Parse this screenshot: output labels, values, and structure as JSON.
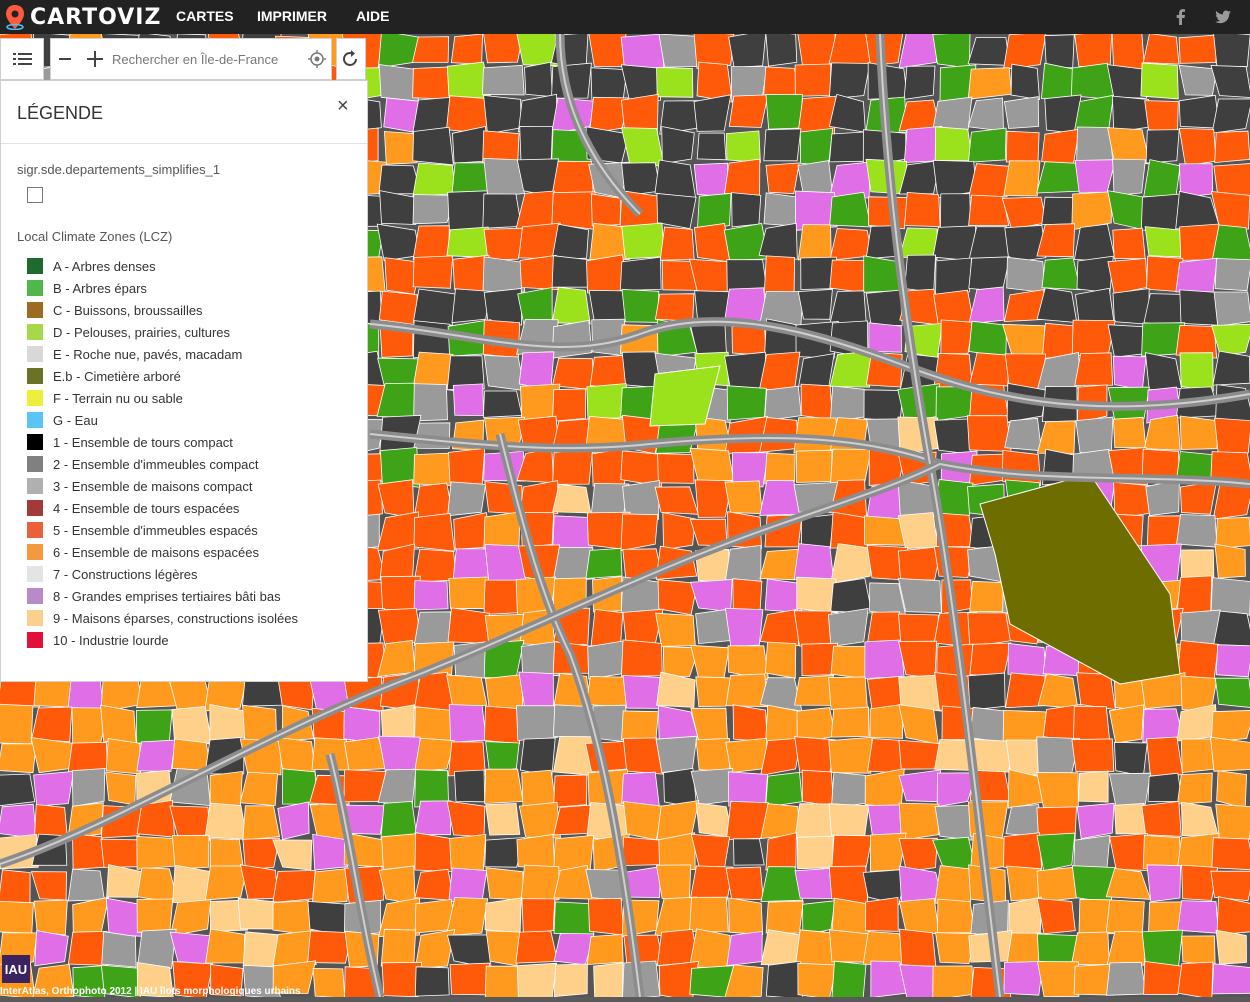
{
  "app": {
    "name": "CARTOVIZ",
    "nav": [
      "CARTES",
      "IMPRIMER",
      "AIDE"
    ],
    "social": [
      {
        "icon": "facebook-icon"
      },
      {
        "icon": "twitter-icon"
      }
    ]
  },
  "toolbar": {
    "search_placeholder": "Rechercher en Île-de-France",
    "buttons": [
      "legend-toggle-icon",
      "zoom-out-icon",
      "zoom-in-icon",
      "geolocate-icon",
      "reset-icon"
    ]
  },
  "legend": {
    "title": "LÉGENDE",
    "close_label": "×",
    "layer_name": "sigr.sde.departements_simplifies_1",
    "lcz_title": "Local Climate Zones (LCZ)",
    "items": [
      {
        "label": "A - Arbres denses",
        "color": "#1f6b2f"
      },
      {
        "label": "B - Arbres épars",
        "color": "#4fb84a"
      },
      {
        "label": "C - Buissons, broussailles",
        "color": "#9c6b21"
      },
      {
        "label": "D - Pelouses, prairies, cultures",
        "color": "#a6d84a"
      },
      {
        "label": "E - Roche nue, pavés, macadam",
        "color": "#d8d8d8"
      },
      {
        "label": "E.b - Cimetière arboré",
        "color": "#6b7226"
      },
      {
        "label": "F - Terrain nu ou sable",
        "color": "#ecf03a"
      },
      {
        "label": "G - Eau",
        "color": "#5bc4f4"
      },
      {
        "label": "1 - Ensemble de tours compact",
        "color": "#000000"
      },
      {
        "label": "2 - Ensemble d'immeubles compact",
        "color": "#808080"
      },
      {
        "label": "3 - Ensemble de maisons compact",
        "color": "#b0b0b0"
      },
      {
        "label": "4 - Ensemble de tours espacées",
        "color": "#a3393b"
      },
      {
        "label": "5 - Ensemble d'immeubles espacés",
        "color": "#e9613a"
      },
      {
        "label": "6 - Ensemble de maisons espacées",
        "color": "#f5993e"
      },
      {
        "label": "7 - Constructions légères",
        "color": "#e4e4e4"
      },
      {
        "label": "8 - Grandes emprises tertiaires bâti bas",
        "color": "#b88bc8"
      },
      {
        "label": "9 - Maisons éparses, constructions isolées",
        "color": "#fbd08b"
      },
      {
        "label": "10 - Industrie lourde",
        "color": "#e0103a"
      }
    ]
  },
  "map": {
    "attribution": "InterAtlas, Orthophoto 2012 | IAU îlots morphologiques urbains",
    "iau_logo": "IAU",
    "palette": {
      "orange_red": "#ff5a0a",
      "orange": "#ff9a1e",
      "dark_grey": "#3f3f3f",
      "mid_grey": "#9a9a9a",
      "green": "#3fa318",
      "lime": "#9be21c",
      "violet": "#e06ee6",
      "beige": "#ffd08a",
      "olive": "#6e6e00",
      "brown": "#8a3a0a",
      "road": "#8c8c8c"
    }
  }
}
